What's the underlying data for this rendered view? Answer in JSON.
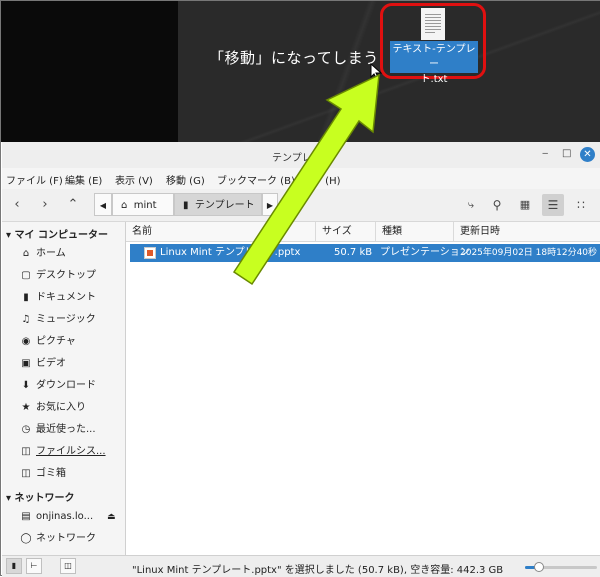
{
  "desktop": {
    "caption": "「移動」になってしまう",
    "icon_label_line1": "テキスト-テンプレー",
    "icon_label_line2": "ト.txt"
  },
  "window": {
    "title": "テンプレート",
    "minimize": "‒",
    "maximize": "□",
    "close": "✕"
  },
  "menu": [
    {
      "label": "ファイル (F)"
    },
    {
      "label": "編集 (E)"
    },
    {
      "label": "表示 (V)"
    },
    {
      "label": "移動 (G)"
    },
    {
      "label": "ブックマーク (B)"
    },
    {
      "label": "ヘルプ (H)"
    }
  ],
  "breadcrumbs": [
    {
      "label": "mint",
      "icon": "home-icon"
    },
    {
      "label": "テンプレート",
      "icon": "folder-icon"
    }
  ],
  "sidebar": {
    "section1": "マイ コンピューター",
    "items1": [
      {
        "label": "ホーム",
        "icon": "home-icon"
      },
      {
        "label": "デスクトップ",
        "icon": "desktop-icon"
      },
      {
        "label": "ドキュメント",
        "icon": "document-icon"
      },
      {
        "label": "ミュージック",
        "icon": "music-icon"
      },
      {
        "label": "ピクチャ",
        "icon": "camera-icon"
      },
      {
        "label": "ビデオ",
        "icon": "video-icon"
      },
      {
        "label": "ダウンロード",
        "icon": "download-icon"
      },
      {
        "label": "お気に入り",
        "icon": "star-icon"
      },
      {
        "label": "最近使った...",
        "icon": "clock-icon"
      },
      {
        "label": "ファイルシス...",
        "icon": "drive-icon"
      },
      {
        "label": "ゴミ箱",
        "icon": "trash-icon"
      }
    ],
    "section2": "ネットワーク",
    "items2": [
      {
        "label": "onjinas.lo...",
        "icon": "network-drive-icon"
      },
      {
        "label": "ネットワーク",
        "icon": "network-icon"
      }
    ]
  },
  "columns": {
    "name": "名前",
    "size": "サイズ",
    "type": "種類",
    "modified": "更新日時"
  },
  "files": [
    {
      "name": "Linux Mint テンプレート.pptx",
      "size": "50.7 kB",
      "type": "プレゼンテーション",
      "modified": "2025年09月02日 18時12分40秒"
    }
  ],
  "status": {
    "text": "\"Linux Mint テンプレート.pptx\" を選択しました (50.7 kB), 空き容量: 442.3 GB",
    "zoom_fraction": 0.2
  },
  "colors": {
    "accent": "#2f7fc8",
    "arrow": "#c8ff20",
    "highlight": "#e01010"
  }
}
